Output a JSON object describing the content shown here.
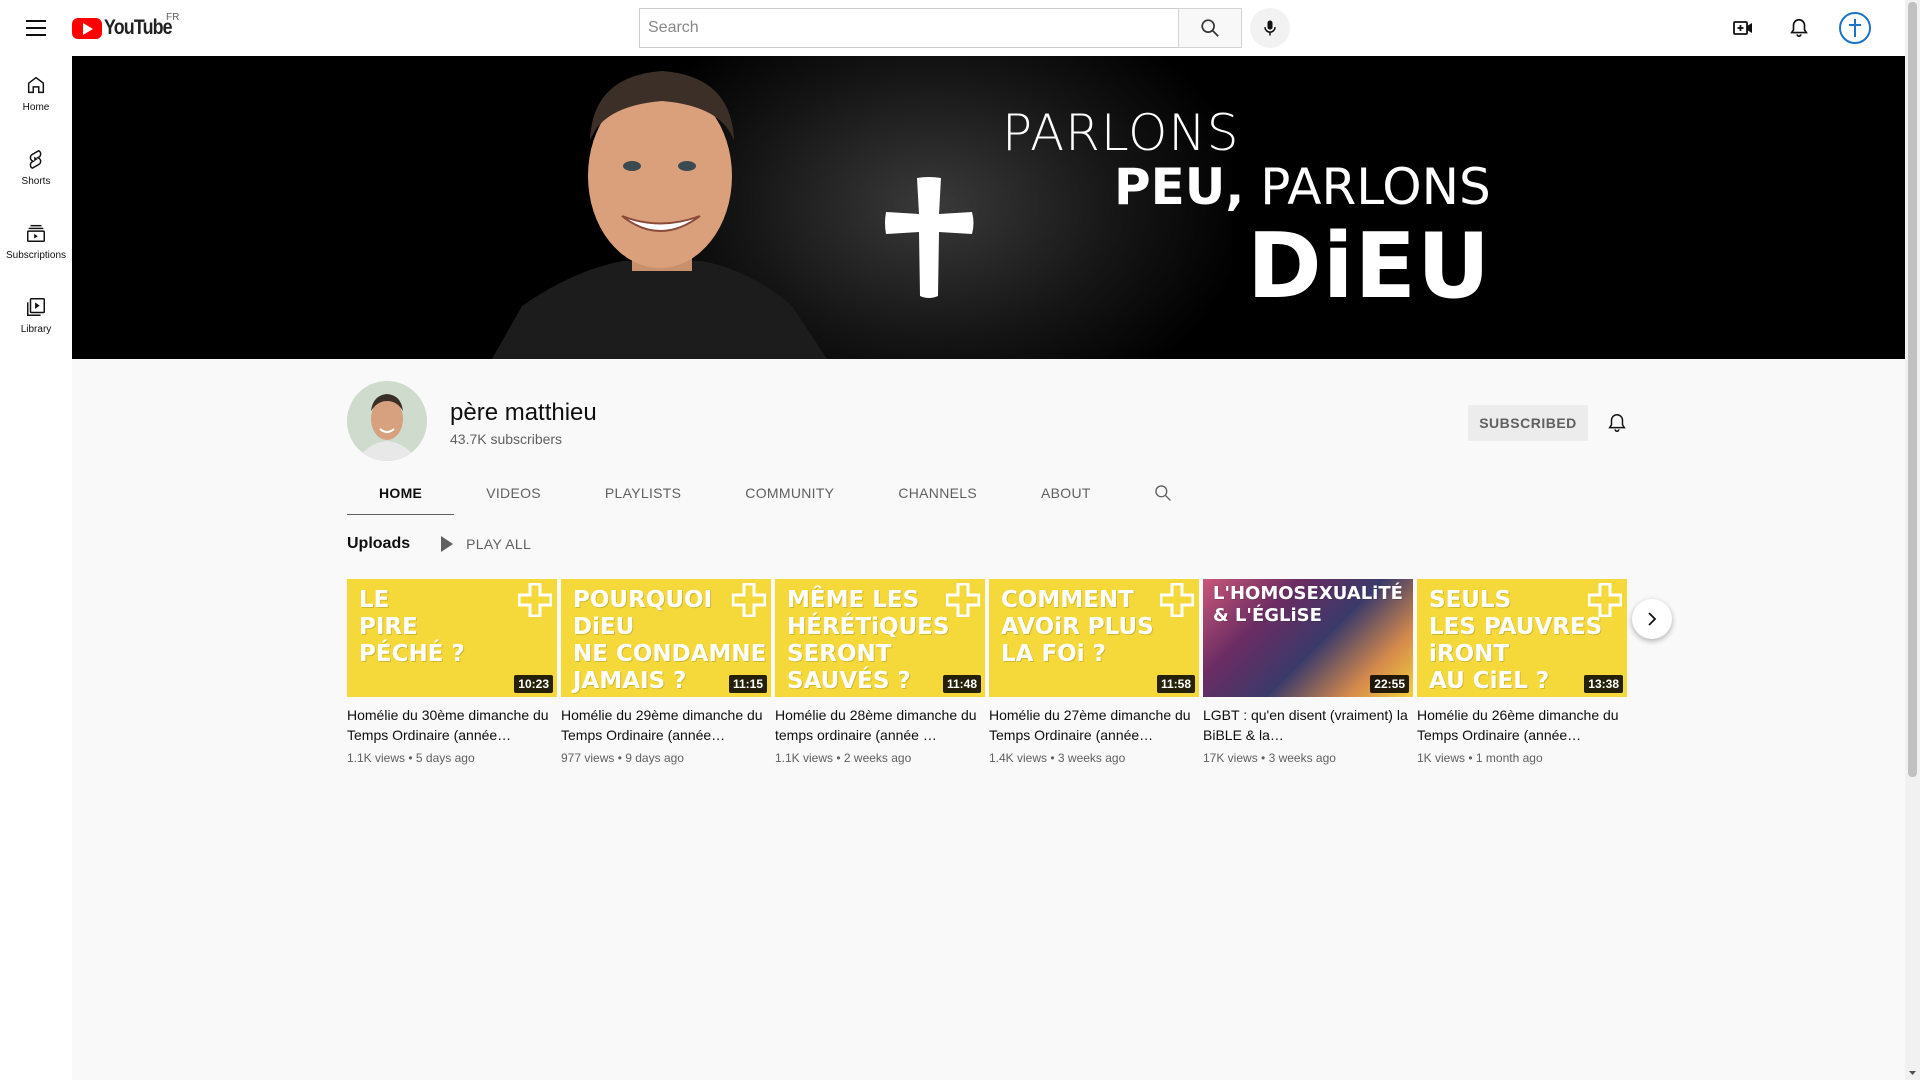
{
  "header": {
    "logo_text": "YouTube",
    "country_code": "FR",
    "search_placeholder": "Search"
  },
  "guide": {
    "items": [
      {
        "label": "Home",
        "icon": "home-icon"
      },
      {
        "label": "Shorts",
        "icon": "shorts-icon"
      },
      {
        "label": "Subscriptions",
        "icon": "subscriptions-icon"
      },
      {
        "label": "Library",
        "icon": "library-icon"
      }
    ]
  },
  "banner": {
    "line1": "PARLONS",
    "line2_bold": "PEU,",
    "line2_rest": " PARLONS",
    "line3": "DiEU"
  },
  "channel": {
    "name": "père matthieu",
    "subscribers": "43.7K subscribers",
    "subscribe_label": "SUBSCRIBED"
  },
  "tabs": [
    {
      "label": "HOME",
      "active": true
    },
    {
      "label": "VIDEOS",
      "active": false
    },
    {
      "label": "PLAYLISTS",
      "active": false
    },
    {
      "label": "COMMUNITY",
      "active": false
    },
    {
      "label": "CHANNELS",
      "active": false
    },
    {
      "label": "ABOUT",
      "active": false
    }
  ],
  "shelf": {
    "title": "Uploads",
    "play_all": "PLAY ALL"
  },
  "videos": [
    {
      "thumb_lines": [
        "LE",
        "PIRE",
        "PÉCHÉ  ?"
      ],
      "duration": "10:23",
      "title": "Homélie du 30ème dimanche du Temps Ordinaire (année…",
      "views": "1.1K views",
      "age": "5 days ago"
    },
    {
      "thumb_lines": [
        "POURQUOI",
        "DiEU",
        "NE CONDAMNE",
        "JAMAIS ?"
      ],
      "duration": "11:15",
      "title": "Homélie du 29ème dimanche du Temps Ordinaire (année…",
      "views": "977 views",
      "age": "9 days ago"
    },
    {
      "thumb_lines": [
        "MÊME LES",
        "HÉRÉTiQUES",
        "SERONT",
        "SAUVÉS ?"
      ],
      "duration": "11:48",
      "title": "Homélie du 28ème dimanche du temps ordinaire (année …",
      "views": "1.1K views",
      "age": "2 weeks ago"
    },
    {
      "thumb_lines": [
        "COMMENT",
        "AVOiR PLUS",
        "LA FOi ?"
      ],
      "duration": "11:58",
      "title": "Homélie du 27ème dimanche du Temps Ordinaire (année…",
      "views": "1.4K views",
      "age": "3 weeks ago"
    },
    {
      "thumb_lines": [
        "L'HOMOSEXUALiTÉ",
        "& L'ÉGLiSE"
      ],
      "duration": "22:55",
      "title": "LGBT : qu'en disent (vraiment) la BiBLE & la…",
      "views": "17K views",
      "age": "3 weeks ago"
    },
    {
      "thumb_lines": [
        "SEULS",
        "LES PAUVRES",
        "iRONT",
        "AU CiEL  ?"
      ],
      "duration": "13:38",
      "title": "Homélie du 26ème dimanche du Temps Ordinaire (année…",
      "views": "1K views",
      "age": "1 month ago"
    }
  ],
  "colors": {
    "brand_red": "#ff0000",
    "thumb_yellow": "#f5d93a",
    "thumb_teal": "#2aa5a0"
  }
}
